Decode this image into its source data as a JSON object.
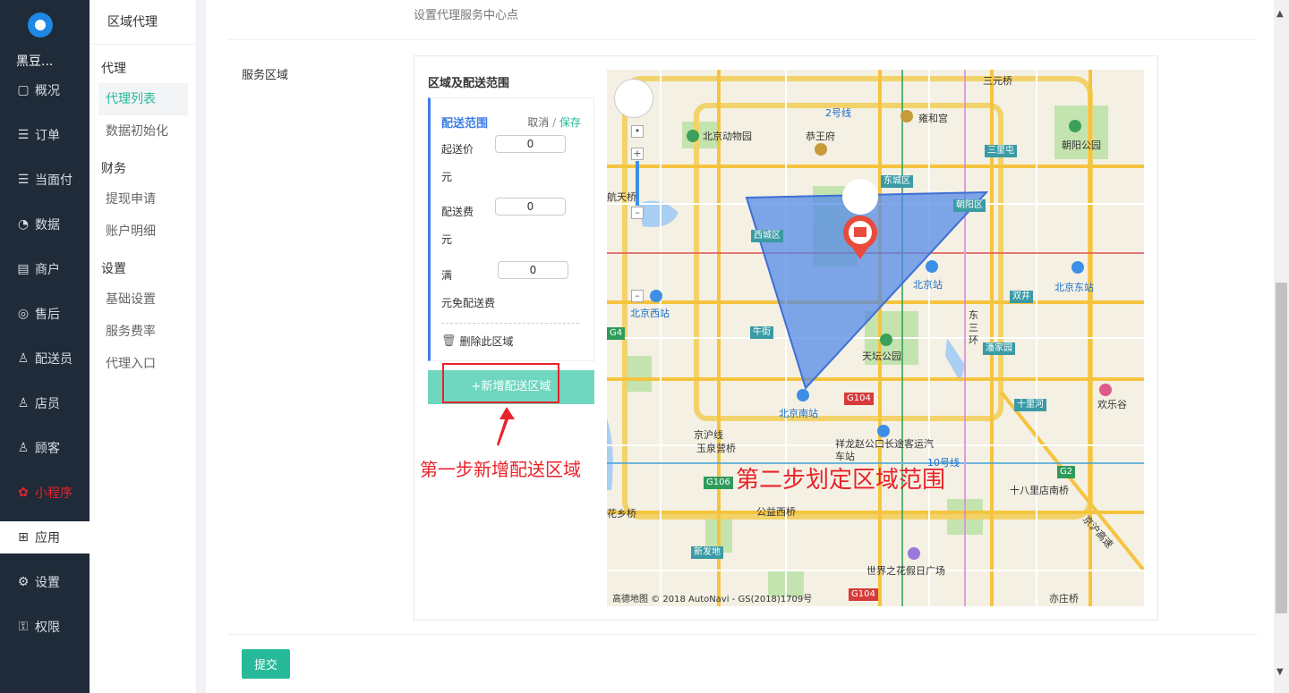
{
  "nav": {
    "brand": "黑豆...",
    "items": [
      {
        "label": "概况",
        "icon": "overview-icon",
        "glyph": "▢"
      },
      {
        "label": "订单",
        "icon": "order-icon",
        "glyph": "☰"
      },
      {
        "label": "当面付",
        "icon": "pay-icon",
        "glyph": "☰"
      },
      {
        "label": "数据",
        "icon": "chart-icon",
        "glyph": "◔"
      },
      {
        "label": "商户",
        "icon": "shop-icon",
        "glyph": "▤"
      },
      {
        "label": "售后",
        "icon": "service-icon",
        "glyph": "◎"
      },
      {
        "label": "配送员",
        "icon": "courier-icon",
        "glyph": "♙"
      },
      {
        "label": "店员",
        "icon": "clerk-icon",
        "glyph": "♙"
      },
      {
        "label": "顾客",
        "icon": "customer-icon",
        "glyph": "♙"
      },
      {
        "label": "小程序",
        "icon": "miniapp-icon",
        "glyph": "✿"
      },
      {
        "label": "应用",
        "icon": "apps-icon",
        "glyph": "⊞"
      },
      {
        "label": "设置",
        "icon": "gear-icon",
        "glyph": "⚙"
      },
      {
        "label": "权限",
        "icon": "lock-icon",
        "glyph": "⚿"
      }
    ]
  },
  "subnav": {
    "title": "区域代理",
    "groups": {
      "agent": "代理",
      "finance": "财务",
      "settings": "设置"
    },
    "items": {
      "agent_list": "代理列表",
      "data_init": "数据初始化",
      "withdraw": "提现申请",
      "account_detail": "账户明细",
      "basic_settings": "基础设置",
      "service_rate": "服务费率",
      "agent_entry": "代理入口"
    }
  },
  "form": {
    "center_hint": "设置代理服务中心点",
    "service_area_label": "服务区域",
    "area_title": "区域及配送范围",
    "zone": {
      "name": "配送范围",
      "cancel": "取消",
      "sep": "/",
      "save": "保存",
      "min_price_label": "起送价",
      "min_price_value": "0",
      "fee_label": "配送费",
      "fee_value": "0",
      "full_label": "满",
      "full_value": "0",
      "unit": "元",
      "free_label": "元免配送费",
      "delete_label": "删除此区域"
    },
    "add_zone": "+新增配送区域",
    "submit": "提交"
  },
  "annotations": {
    "step1": "第一步新增配送区域",
    "step2": "第二步划定区域范围"
  },
  "map": {
    "labels": {
      "sanyuanqiao": "三元桥",
      "zoo": "北京动物园",
      "gongwangfu": "恭王府",
      "yonghegong": "雍和宫",
      "line2": "2号线",
      "chaoyang_park": "朝阳公园",
      "sanlitun": "三里屯",
      "dongcheng": "东城区",
      "chaoyang": "朝阳区",
      "xicheng": "西城区",
      "hangtianqiao": "航天桥",
      "beijing_station": "北京站",
      "beijing_east": "北京东站",
      "beijing_west": "北京西站",
      "shuangjing": "双井",
      "dong3huan": "东三环",
      "niujie": "牛街",
      "tiantan": "天坛公园",
      "panjiayuan": "潘家园",
      "beijing_south": "北京南站",
      "g104": "G104",
      "shilihe": "十里河",
      "happy_valley": "欢乐谷",
      "jinghu": "京沪线",
      "yuquanying": "玉泉营桥",
      "xianglong": "祥龙赵公口长途客运汽车站",
      "line10": "10号线",
      "g2": "G2",
      "g106": "G106",
      "shibali": "十八里店南桥",
      "huaxiang": "花乡桥",
      "gongyi": "公益西桥",
      "jinghu_exp": "京沪高速",
      "xinfadi": "新发地",
      "world_flower": "世界之花假日广场",
      "yizhuang": "亦庄桥",
      "g4": "G4"
    },
    "credit": "高德地图 © 2018 AutoNavi - GS(2018)1709号"
  },
  "colors": {
    "accent": "#26b99a",
    "nav_bg": "#1f2b38",
    "zone_border": "#3d7ee6",
    "annotation_red": "#e8232b",
    "polygon_fill": "#4f86e8"
  }
}
